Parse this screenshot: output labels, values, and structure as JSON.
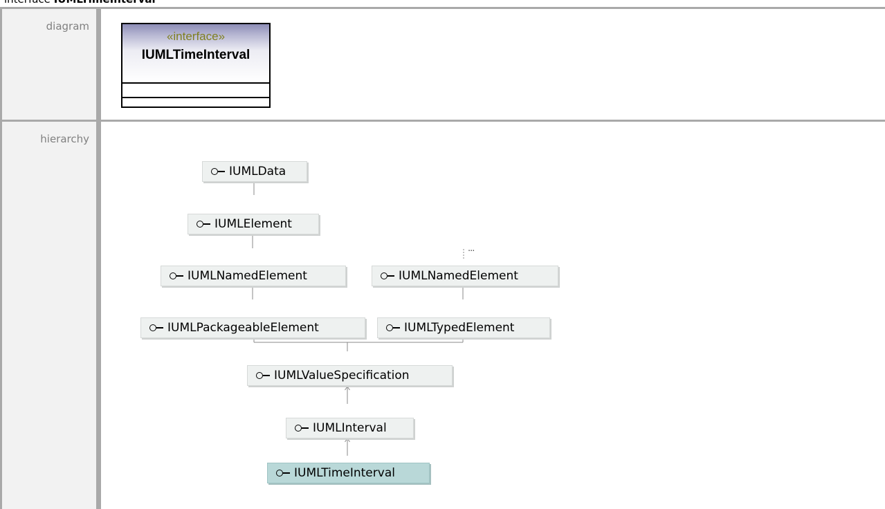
{
  "header": {
    "kind": "interface",
    "name": "IUMLTimeInterval"
  },
  "rows": {
    "diagram_label": "diagram",
    "hierarchy_label": "hierarchy"
  },
  "uml_class": {
    "stereotype": "«interface»",
    "name": "IUMLTimeInterval"
  },
  "hierarchy": {
    "nodes": {
      "data": "IUMLData",
      "element": "IUMLElement",
      "named_element_left": "IUMLNamedElement",
      "named_element_right": "IUMLNamedElement",
      "packageable_element": "IUMLPackageableElement",
      "typed_element": "IUMLTypedElement",
      "value_specification": "IUMLValueSpecification",
      "interval": "IUMLInterval",
      "time_interval": "IUMLTimeInterval"
    },
    "more_marker": "..."
  },
  "colors": {
    "frame": "#a9a9a9",
    "node_bg": "#eef1f0",
    "current_node_bg": "#b9d8d8",
    "stereotype": "#7f7f1f"
  }
}
